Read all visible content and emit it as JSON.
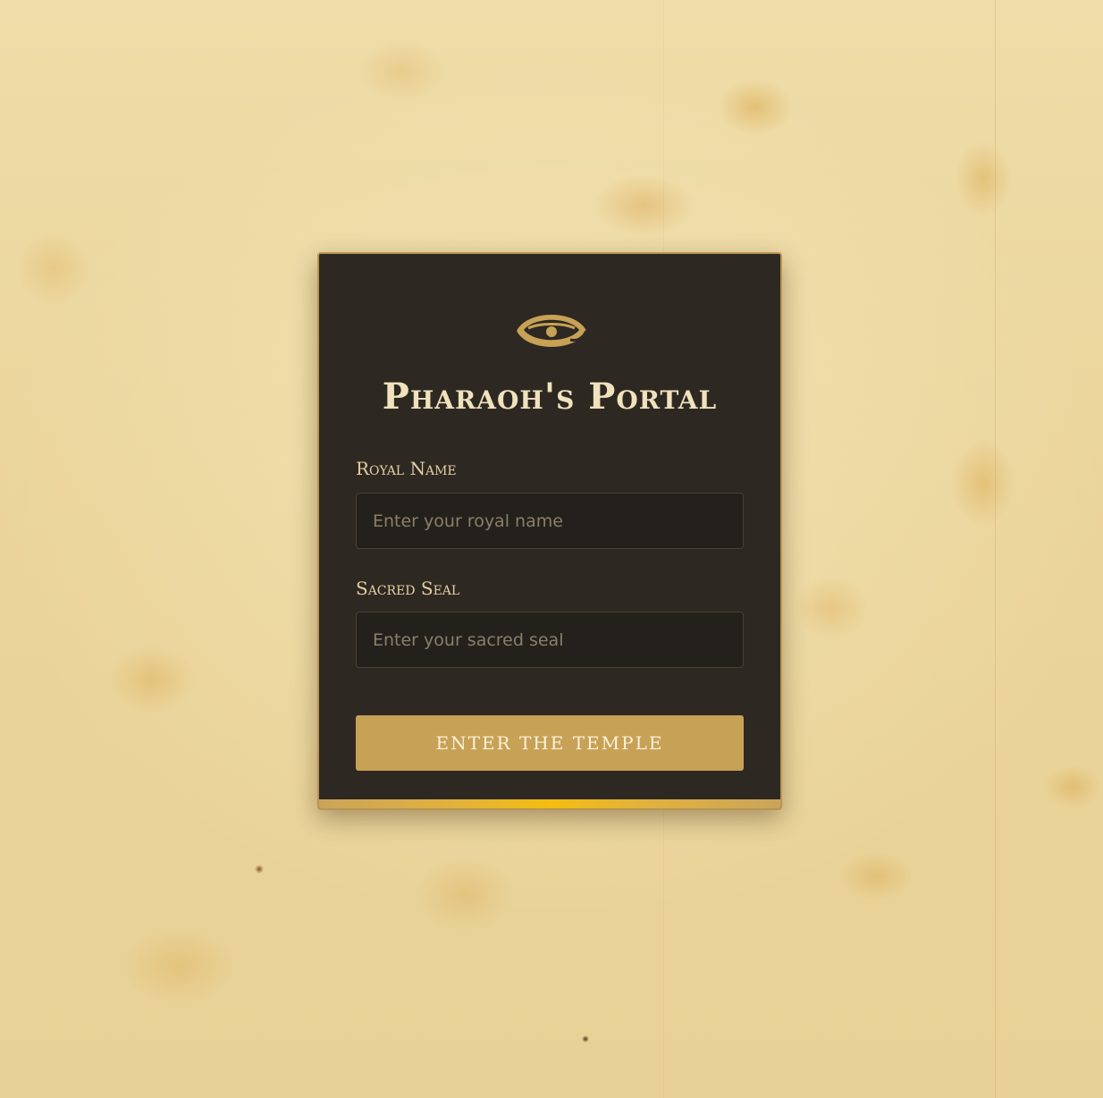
{
  "page": {
    "background_color": "#ecd9a3"
  },
  "login_card": {
    "emblem_icon": "eye-of-horus-icon",
    "title": "Pharaoh's Portal",
    "fields": [
      {
        "label": "Royal Name",
        "placeholder": "Enter your royal name",
        "value": ""
      },
      {
        "label": "Sacred Seal",
        "placeholder": "Enter your sacred seal",
        "value": ""
      }
    ],
    "submit_label": "ENTER THE TEMPLE",
    "colors": {
      "card_background": "#2e2822",
      "gold_accent": "#c7a156",
      "title_text": "#f0e2bd",
      "accent_bar_center": "#f5bd10"
    }
  }
}
